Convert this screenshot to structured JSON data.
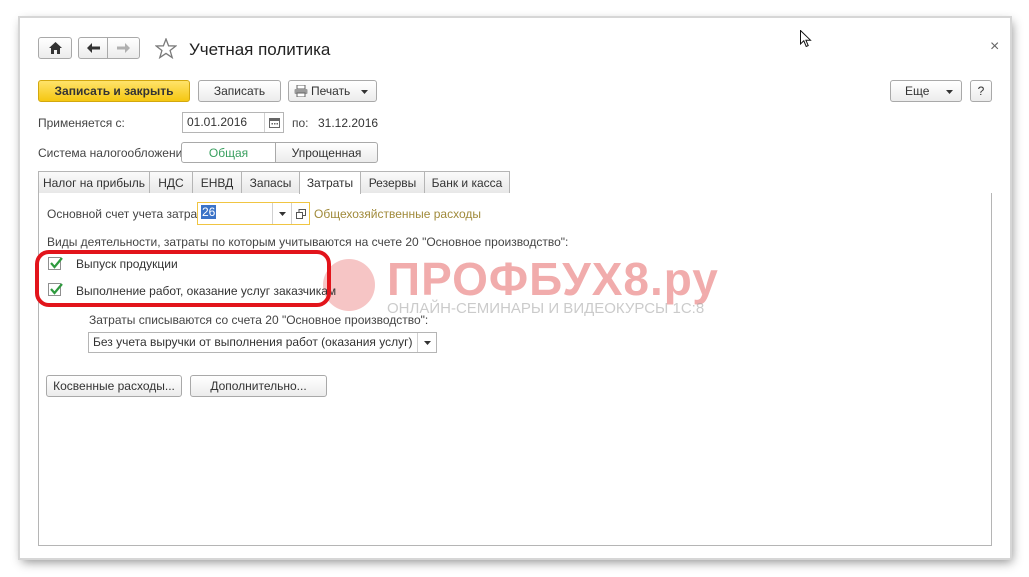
{
  "window": {
    "title": "Учетная политика",
    "close_glyph": "×"
  },
  "toolbar": {
    "save_close_label": "Записать и закрыть",
    "save_label": "Записать",
    "print_label": "Печать",
    "more_label": "Еще",
    "help_label": "?"
  },
  "period": {
    "from_label": "Применяется с:",
    "from_value": "01.01.2016",
    "to_label": "по:",
    "to_value": "31.12.2016"
  },
  "tax_system": {
    "label": "Система налогообложения:",
    "options": [
      "Общая",
      "Упрощенная"
    ],
    "selected": "Общая"
  },
  "tabs": [
    {
      "label": "Налог на прибыль"
    },
    {
      "label": "НДС"
    },
    {
      "label": "ЕНВД"
    },
    {
      "label": "Запасы"
    },
    {
      "label": "Затраты"
    },
    {
      "label": "Резервы"
    },
    {
      "label": "Банк и касса"
    }
  ],
  "active_tab": "Затраты",
  "costs": {
    "account_label": "Основной счет учета затрат:",
    "account_value": "26",
    "account_name": "Общехозяйственные расходы",
    "activities_label": "Виды деятельности, затраты по которым учитываются на счете 20 \"Основное производство\":",
    "activities": [
      {
        "label": "Выпуск продукции",
        "checked": true
      },
      {
        "label": "Выполнение работ, оказание услуг заказчикам",
        "checked": true
      }
    ],
    "writeoff_label": "Затраты списываются со счета 20 \"Основное производство\":",
    "writeoff_value": "Без учета выручки от выполнения работ (оказания услуг)",
    "indirect_button": "Косвенные расходы...",
    "additional_button": "Дополнительно..."
  },
  "watermark": {
    "brand": "ПРОФБУХ8.ру",
    "subtitle": "ОНЛАЙН-СЕМИНАРЫ И ВИДЕОКУРСЫ 1С:8"
  },
  "colors": {
    "primary_button": "#f5c712",
    "highlight": "#e2141b",
    "link_account": "#a08a3a",
    "selected_option": "#3aa060"
  }
}
